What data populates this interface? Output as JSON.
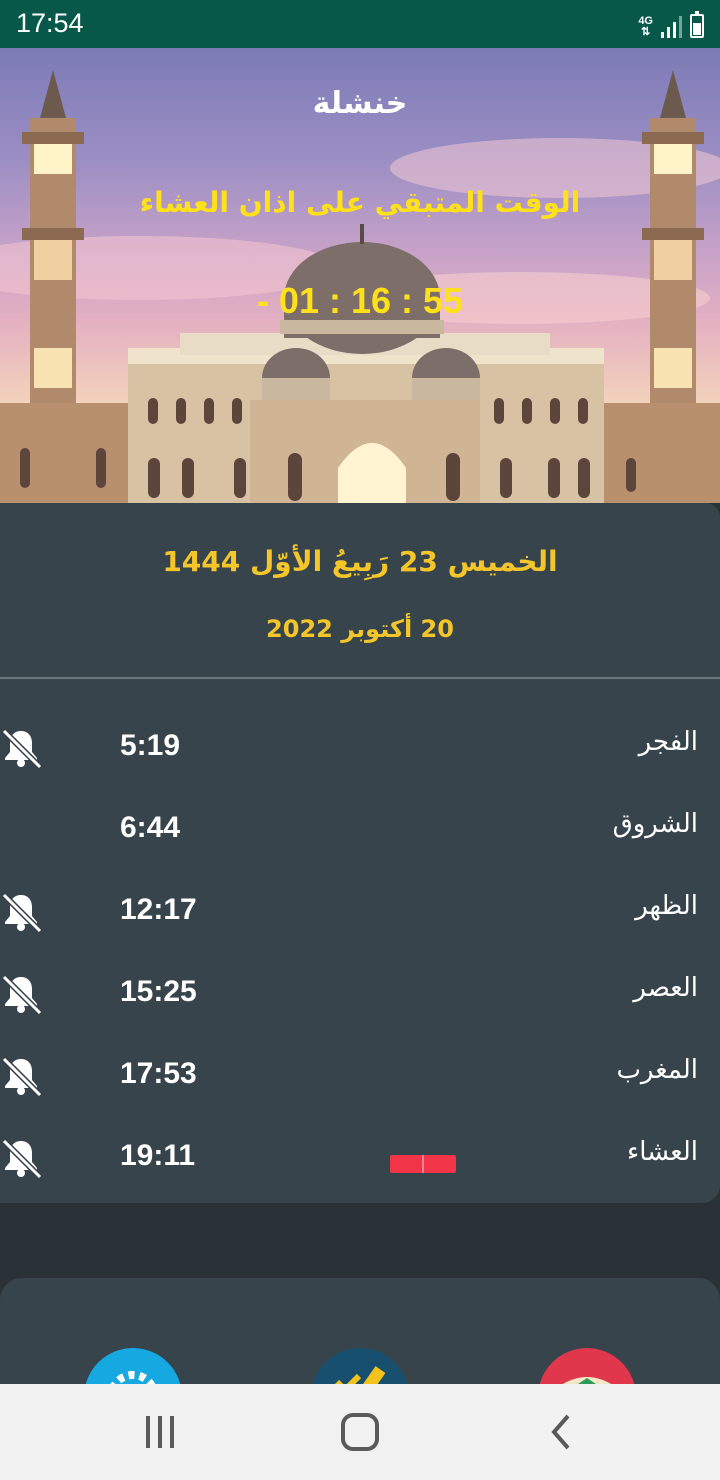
{
  "status_bar": {
    "time": "17:54",
    "network": "4G",
    "icons": [
      "network-type-icon",
      "signal-icon",
      "battery-icon"
    ]
  },
  "header": {
    "city": "خنشلة",
    "remaining_label": "الوقت المتبقي على اذان العشاء",
    "countdown": "- 01 : 16 : 55"
  },
  "dates": {
    "hijri": "الخميس 23  رَبِيعُ الأوّل 1444",
    "gregorian": "20  أكتوبر 2022"
  },
  "prayers": [
    {
      "name": "الفجر",
      "time": "5:19",
      "alarm_icon": "bell-off-icon"
    },
    {
      "name": "الشروق",
      "time": "6:44",
      "alarm_icon": ""
    },
    {
      "name": "الظهر",
      "time": "12:17",
      "alarm_icon": "bell-off-icon"
    },
    {
      "name": "العصر",
      "time": "15:25",
      "alarm_icon": "bell-off-icon"
    },
    {
      "name": "المغرب",
      "time": "17:53",
      "alarm_icon": "bell-off-icon"
    },
    {
      "name": "العشاء",
      "time": "19:11",
      "alarm_icon": "bell-off-icon",
      "next_prayer_indicator": true
    }
  ],
  "bottom_actions": [
    {
      "icon": "settings-gear-icon"
    },
    {
      "icon": "tasks-check-icon"
    },
    {
      "icon": "quran-book-icon"
    }
  ],
  "nav_bar": {
    "icons": [
      "recent-apps-icon",
      "home-icon",
      "back-icon"
    ]
  },
  "colors": {
    "status_bar": "#075848",
    "accent_yellow": "#ffe11a",
    "date_gold": "#f5c62a",
    "card": "#37444c",
    "indicator_red": "#f23447"
  }
}
